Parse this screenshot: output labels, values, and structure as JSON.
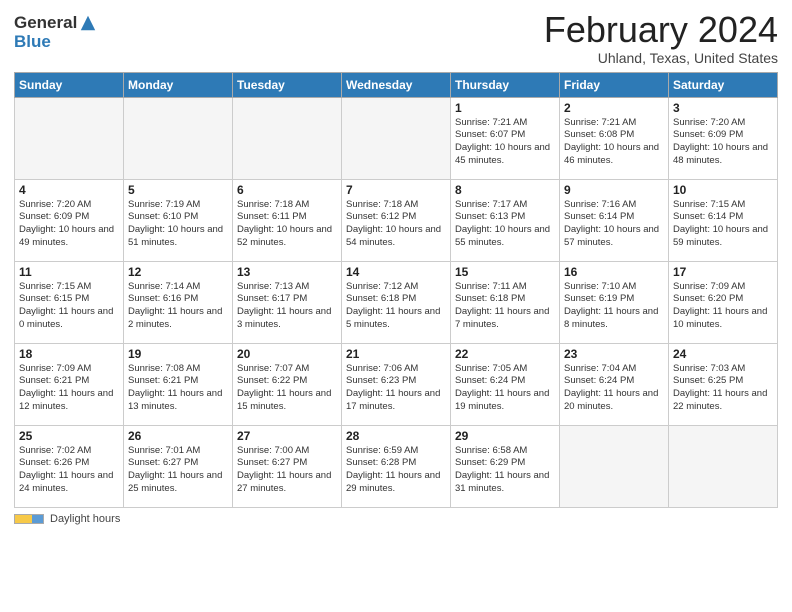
{
  "header": {
    "logo_general": "General",
    "logo_blue": "Blue",
    "month_title": "February 2024",
    "location": "Uhland, Texas, United States"
  },
  "days_of_week": [
    "Sunday",
    "Monday",
    "Tuesday",
    "Wednesday",
    "Thursday",
    "Friday",
    "Saturday"
  ],
  "weeks": [
    [
      {
        "day": "",
        "sunrise": "",
        "sunset": "",
        "daylight": "",
        "empty": true
      },
      {
        "day": "",
        "sunrise": "",
        "sunset": "",
        "daylight": "",
        "empty": true
      },
      {
        "day": "",
        "sunrise": "",
        "sunset": "",
        "daylight": "",
        "empty": true
      },
      {
        "day": "",
        "sunrise": "",
        "sunset": "",
        "daylight": "",
        "empty": true
      },
      {
        "day": "1",
        "sunrise": "Sunrise: 7:21 AM",
        "sunset": "Sunset: 6:07 PM",
        "daylight": "Daylight: 10 hours and 45 minutes.",
        "empty": false
      },
      {
        "day": "2",
        "sunrise": "Sunrise: 7:21 AM",
        "sunset": "Sunset: 6:08 PM",
        "daylight": "Daylight: 10 hours and 46 minutes.",
        "empty": false
      },
      {
        "day": "3",
        "sunrise": "Sunrise: 7:20 AM",
        "sunset": "Sunset: 6:09 PM",
        "daylight": "Daylight: 10 hours and 48 minutes.",
        "empty": false
      }
    ],
    [
      {
        "day": "4",
        "sunrise": "Sunrise: 7:20 AM",
        "sunset": "Sunset: 6:09 PM",
        "daylight": "Daylight: 10 hours and 49 minutes.",
        "empty": false
      },
      {
        "day": "5",
        "sunrise": "Sunrise: 7:19 AM",
        "sunset": "Sunset: 6:10 PM",
        "daylight": "Daylight: 10 hours and 51 minutes.",
        "empty": false
      },
      {
        "day": "6",
        "sunrise": "Sunrise: 7:18 AM",
        "sunset": "Sunset: 6:11 PM",
        "daylight": "Daylight: 10 hours and 52 minutes.",
        "empty": false
      },
      {
        "day": "7",
        "sunrise": "Sunrise: 7:18 AM",
        "sunset": "Sunset: 6:12 PM",
        "daylight": "Daylight: 10 hours and 54 minutes.",
        "empty": false
      },
      {
        "day": "8",
        "sunrise": "Sunrise: 7:17 AM",
        "sunset": "Sunset: 6:13 PM",
        "daylight": "Daylight: 10 hours and 55 minutes.",
        "empty": false
      },
      {
        "day": "9",
        "sunrise": "Sunrise: 7:16 AM",
        "sunset": "Sunset: 6:14 PM",
        "daylight": "Daylight: 10 hours and 57 minutes.",
        "empty": false
      },
      {
        "day": "10",
        "sunrise": "Sunrise: 7:15 AM",
        "sunset": "Sunset: 6:14 PM",
        "daylight": "Daylight: 10 hours and 59 minutes.",
        "empty": false
      }
    ],
    [
      {
        "day": "11",
        "sunrise": "Sunrise: 7:15 AM",
        "sunset": "Sunset: 6:15 PM",
        "daylight": "Daylight: 11 hours and 0 minutes.",
        "empty": false
      },
      {
        "day": "12",
        "sunrise": "Sunrise: 7:14 AM",
        "sunset": "Sunset: 6:16 PM",
        "daylight": "Daylight: 11 hours and 2 minutes.",
        "empty": false
      },
      {
        "day": "13",
        "sunrise": "Sunrise: 7:13 AM",
        "sunset": "Sunset: 6:17 PM",
        "daylight": "Daylight: 11 hours and 3 minutes.",
        "empty": false
      },
      {
        "day": "14",
        "sunrise": "Sunrise: 7:12 AM",
        "sunset": "Sunset: 6:18 PM",
        "daylight": "Daylight: 11 hours and 5 minutes.",
        "empty": false
      },
      {
        "day": "15",
        "sunrise": "Sunrise: 7:11 AM",
        "sunset": "Sunset: 6:18 PM",
        "daylight": "Daylight: 11 hours and 7 minutes.",
        "empty": false
      },
      {
        "day": "16",
        "sunrise": "Sunrise: 7:10 AM",
        "sunset": "Sunset: 6:19 PM",
        "daylight": "Daylight: 11 hours and 8 minutes.",
        "empty": false
      },
      {
        "day": "17",
        "sunrise": "Sunrise: 7:09 AM",
        "sunset": "Sunset: 6:20 PM",
        "daylight": "Daylight: 11 hours and 10 minutes.",
        "empty": false
      }
    ],
    [
      {
        "day": "18",
        "sunrise": "Sunrise: 7:09 AM",
        "sunset": "Sunset: 6:21 PM",
        "daylight": "Daylight: 11 hours and 12 minutes.",
        "empty": false
      },
      {
        "day": "19",
        "sunrise": "Sunrise: 7:08 AM",
        "sunset": "Sunset: 6:21 PM",
        "daylight": "Daylight: 11 hours and 13 minutes.",
        "empty": false
      },
      {
        "day": "20",
        "sunrise": "Sunrise: 7:07 AM",
        "sunset": "Sunset: 6:22 PM",
        "daylight": "Daylight: 11 hours and 15 minutes.",
        "empty": false
      },
      {
        "day": "21",
        "sunrise": "Sunrise: 7:06 AM",
        "sunset": "Sunset: 6:23 PM",
        "daylight": "Daylight: 11 hours and 17 minutes.",
        "empty": false
      },
      {
        "day": "22",
        "sunrise": "Sunrise: 7:05 AM",
        "sunset": "Sunset: 6:24 PM",
        "daylight": "Daylight: 11 hours and 19 minutes.",
        "empty": false
      },
      {
        "day": "23",
        "sunrise": "Sunrise: 7:04 AM",
        "sunset": "Sunset: 6:24 PM",
        "daylight": "Daylight: 11 hours and 20 minutes.",
        "empty": false
      },
      {
        "day": "24",
        "sunrise": "Sunrise: 7:03 AM",
        "sunset": "Sunset: 6:25 PM",
        "daylight": "Daylight: 11 hours and 22 minutes.",
        "empty": false
      }
    ],
    [
      {
        "day": "25",
        "sunrise": "Sunrise: 7:02 AM",
        "sunset": "Sunset: 6:26 PM",
        "daylight": "Daylight: 11 hours and 24 minutes.",
        "empty": false
      },
      {
        "day": "26",
        "sunrise": "Sunrise: 7:01 AM",
        "sunset": "Sunset: 6:27 PM",
        "daylight": "Daylight: 11 hours and 25 minutes.",
        "empty": false
      },
      {
        "day": "27",
        "sunrise": "Sunrise: 7:00 AM",
        "sunset": "Sunset: 6:27 PM",
        "daylight": "Daylight: 11 hours and 27 minutes.",
        "empty": false
      },
      {
        "day": "28",
        "sunrise": "Sunrise: 6:59 AM",
        "sunset": "Sunset: 6:28 PM",
        "daylight": "Daylight: 11 hours and 29 minutes.",
        "empty": false
      },
      {
        "day": "29",
        "sunrise": "Sunrise: 6:58 AM",
        "sunset": "Sunset: 6:29 PM",
        "daylight": "Daylight: 11 hours and 31 minutes.",
        "empty": false
      },
      {
        "day": "",
        "sunrise": "",
        "sunset": "",
        "daylight": "",
        "empty": true
      },
      {
        "day": "",
        "sunrise": "",
        "sunset": "",
        "daylight": "",
        "empty": true
      }
    ]
  ],
  "footer": {
    "daylight_label": "Daylight hours"
  }
}
